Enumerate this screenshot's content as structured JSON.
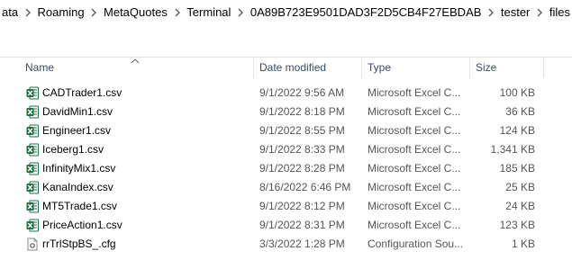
{
  "breadcrumb": [
    "ata",
    "Roaming",
    "MetaQuotes",
    "Terminal",
    "0A89B723E9501DAD3F2D5CB4F27EBDAB",
    "tester",
    "files"
  ],
  "columns": {
    "name": "Name",
    "date": "Date modified",
    "type": "Type",
    "size": "Size"
  },
  "files": [
    {
      "name": "CADTrader1.csv",
      "date": "9/1/2022 9:56 AM",
      "type": "Microsoft Excel C...",
      "size": "100 KB",
      "icon": "excel-csv-icon"
    },
    {
      "name": "DavidMin1.csv",
      "date": "9/1/2022 8:18 PM",
      "type": "Microsoft Excel C...",
      "size": "36 KB",
      "icon": "excel-csv-icon"
    },
    {
      "name": "Engineer1.csv",
      "date": "9/1/2022 8:55 PM",
      "type": "Microsoft Excel C...",
      "size": "124 KB",
      "icon": "excel-csv-icon"
    },
    {
      "name": "Iceberg1.csv",
      "date": "9/1/2022 8:33 PM",
      "type": "Microsoft Excel C...",
      "size": "1,341 KB",
      "icon": "excel-csv-icon"
    },
    {
      "name": "InfinityMix1.csv",
      "date": "9/1/2022 8:28 PM",
      "type": "Microsoft Excel C...",
      "size": "185 KB",
      "icon": "excel-csv-icon"
    },
    {
      "name": "KanaIndex.csv",
      "date": "8/16/2022 6:46 PM",
      "type": "Microsoft Excel C...",
      "size": "25 KB",
      "icon": "excel-csv-icon"
    },
    {
      "name": "MT5Trade1.csv",
      "date": "9/1/2022 8:12 PM",
      "type": "Microsoft Excel C...",
      "size": "24 KB",
      "icon": "excel-csv-icon"
    },
    {
      "name": "PriceAction1.csv",
      "date": "9/1/2022 8:31 PM",
      "type": "Microsoft Excel C...",
      "size": "123 KB",
      "icon": "excel-csv-icon"
    },
    {
      "name": "rrTrlStpBS_.cfg",
      "date": "3/3/2022 1:28 PM",
      "type": "Configuration Sou...",
      "size": "1 KB",
      "icon": "config-file-icon"
    }
  ],
  "colors": {
    "excel_green": "#1d6f42",
    "header_text": "#3a4a6b",
    "divider": "#e5e5e5"
  }
}
